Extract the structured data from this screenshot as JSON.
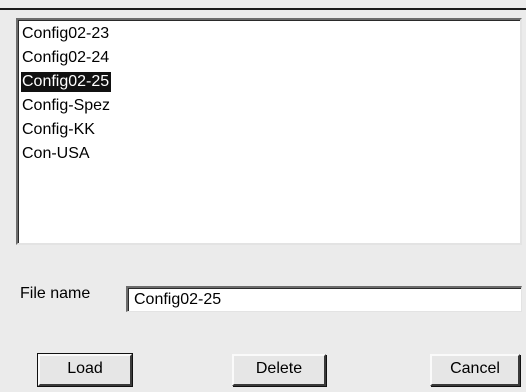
{
  "file_list": {
    "items": [
      {
        "label": "Config02-23",
        "selected": false
      },
      {
        "label": "Config02-24",
        "selected": false
      },
      {
        "label": "Config02-25",
        "selected": true
      },
      {
        "label": "Config-Spez",
        "selected": false
      },
      {
        "label": "Config-KK",
        "selected": false
      },
      {
        "label": "Con-USA",
        "selected": false
      }
    ]
  },
  "file_name": {
    "label": "File name",
    "value": "Config02-25"
  },
  "buttons": {
    "load": "Load",
    "delete": "Delete",
    "cancel": "Cancel"
  },
  "colors": {
    "background": "#ebebeb",
    "selection": "#111111",
    "selection_text": "#ffffff"
  }
}
